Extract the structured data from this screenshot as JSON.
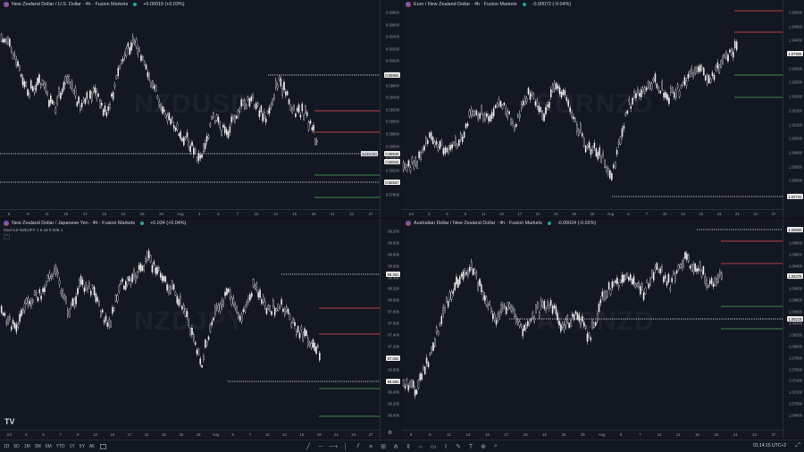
{
  "panes": [
    {
      "id": "nzdusd",
      "title": "New Zealand Dollar / U.S. Dollar · 4h · Fusion Markets",
      "change": "+0.00015 (+0.03%)",
      "watermark": "NZDUSD",
      "price_ticks": [
        "0.60800",
        "0.60600",
        "0.60400",
        "0.60200",
        "0.60000",
        "0.59800",
        "0.59600",
        "0.59400",
        "0.59200",
        "0.59000",
        "0.58800",
        "0.58600",
        "0.58400",
        "0.58200",
        "0.58000",
        "0.57800"
      ],
      "badges": [
        {
          "text": "0.59964",
          "style": "light"
        },
        {
          "text": "0.58946",
          "style": "light"
        },
        {
          "text": "0.58842",
          "style": "light"
        },
        {
          "text": "0.58557",
          "style": "light"
        }
      ],
      "symbol_tag": "NZDUSD",
      "time_ticks": [
        "8",
        "9",
        "11",
        "15",
        "17",
        "19",
        "23",
        "25",
        "29",
        "Aug",
        "3",
        "5",
        "7",
        "10",
        "13",
        "15",
        "19",
        "21",
        "24",
        "27"
      ]
    },
    {
      "id": "eurnzd",
      "title": "Euro / New Zealand Dollar · 4h · Fusion Markets",
      "change": "-0.00072 (-0.04%)",
      "watermark": "EURNZD",
      "price_ticks": [
        "1.95000",
        "1.94500",
        "1.94000",
        "1.93500",
        "1.93000",
        "1.92500",
        "1.92000",
        "1.91500",
        "1.91000",
        "1.90500",
        "1.90000",
        "1.89500",
        "1.89000",
        "1.88500"
      ],
      "badges": [
        {
          "text": "1.87955",
          "style": "light"
        },
        {
          "text": "1.82741",
          "style": "light"
        }
      ],
      "time_ticks": [
        "Jul",
        "3",
        "6",
        "9",
        "11",
        "15",
        "17",
        "21",
        "23",
        "25",
        "29",
        "Aug",
        "5",
        "7",
        "10",
        "13",
        "15",
        "19",
        "21",
        "24",
        "27"
      ]
    },
    {
      "id": "nzdjpy",
      "title": "New Zealand Dollar / Japanese Yen · 4h · Fusion Markets",
      "change": "+0.034 (+0.04%)",
      "watermark": "NZDJPY",
      "indicator": "hmd 2.0 NZDJPY 1 0.18 0.025 1",
      "price_ticks": [
        "89.200",
        "89.000",
        "88.800",
        "88.600",
        "88.400",
        "88.200",
        "88.000",
        "87.800",
        "87.600",
        "87.400",
        "87.200",
        "87.000",
        "86.800",
        "86.600",
        "86.400",
        "86.200",
        "86.000"
      ],
      "badges": [
        {
          "text": "88.351",
          "style": "light"
        },
        {
          "text": "87.064",
          "style": "light"
        },
        {
          "text": "86.660",
          "style": "light"
        }
      ],
      "time_ticks": [
        "Jul",
        "3",
        "5",
        "7",
        "9",
        "13",
        "15",
        "17",
        "21",
        "23",
        "25",
        "29",
        "Aug",
        "5",
        "7",
        "10",
        "13",
        "15",
        "19",
        "21",
        "24",
        "27"
      ]
    },
    {
      "id": "audnzd",
      "title": "Australian Dollar / New Zealand Dollar · 4h · Fusion Markets",
      "change": "-0.00024 (-0.02%)",
      "watermark": "AUDNZD",
      "price_ticks": [
        "1.10000",
        "1.09800",
        "1.09600",
        "1.09400",
        "1.09200",
        "1.09000",
        "1.08800",
        "1.08600",
        "1.08400",
        "1.08200",
        "1.08000",
        "1.07800",
        "1.07600",
        "1.07400",
        "1.07200",
        "1.07000",
        "1.06800"
      ],
      "badges": [
        {
          "text": "1.09869",
          "style": "light"
        },
        {
          "text": "1.09476",
          "style": "light"
        },
        {
          "text": "1.09219",
          "style": "light"
        }
      ],
      "time_ticks": [
        "6",
        "9",
        "11",
        "13",
        "15",
        "17",
        "20",
        "22",
        "25",
        "29",
        "Aug",
        "5",
        "7",
        "10",
        "13",
        "15",
        "19",
        "21",
        "24",
        "27"
      ]
    }
  ],
  "bottom_bar": {
    "ranges": [
      "1D",
      "5D",
      "1M",
      "3M",
      "6M",
      "YTD",
      "1Y",
      "5Y",
      "All"
    ],
    "clock": "01:14:15 UTC+2",
    "tools": [
      "trend-line",
      "horizontal-line",
      "horizontal-ray",
      "vertical-line",
      "parallel-channel",
      "fib-retracement",
      "gann",
      "pitchfork",
      "price-range",
      "date-range",
      "rectangle",
      "path",
      "brush",
      "text",
      "measure",
      "zoom"
    ]
  },
  "colors": {
    "background": "#131722",
    "candle": "#e6e6e6",
    "resistance": "#ef5350",
    "support": "#4caf50",
    "dotted": "#ffffff"
  },
  "logo_text": "TV"
}
